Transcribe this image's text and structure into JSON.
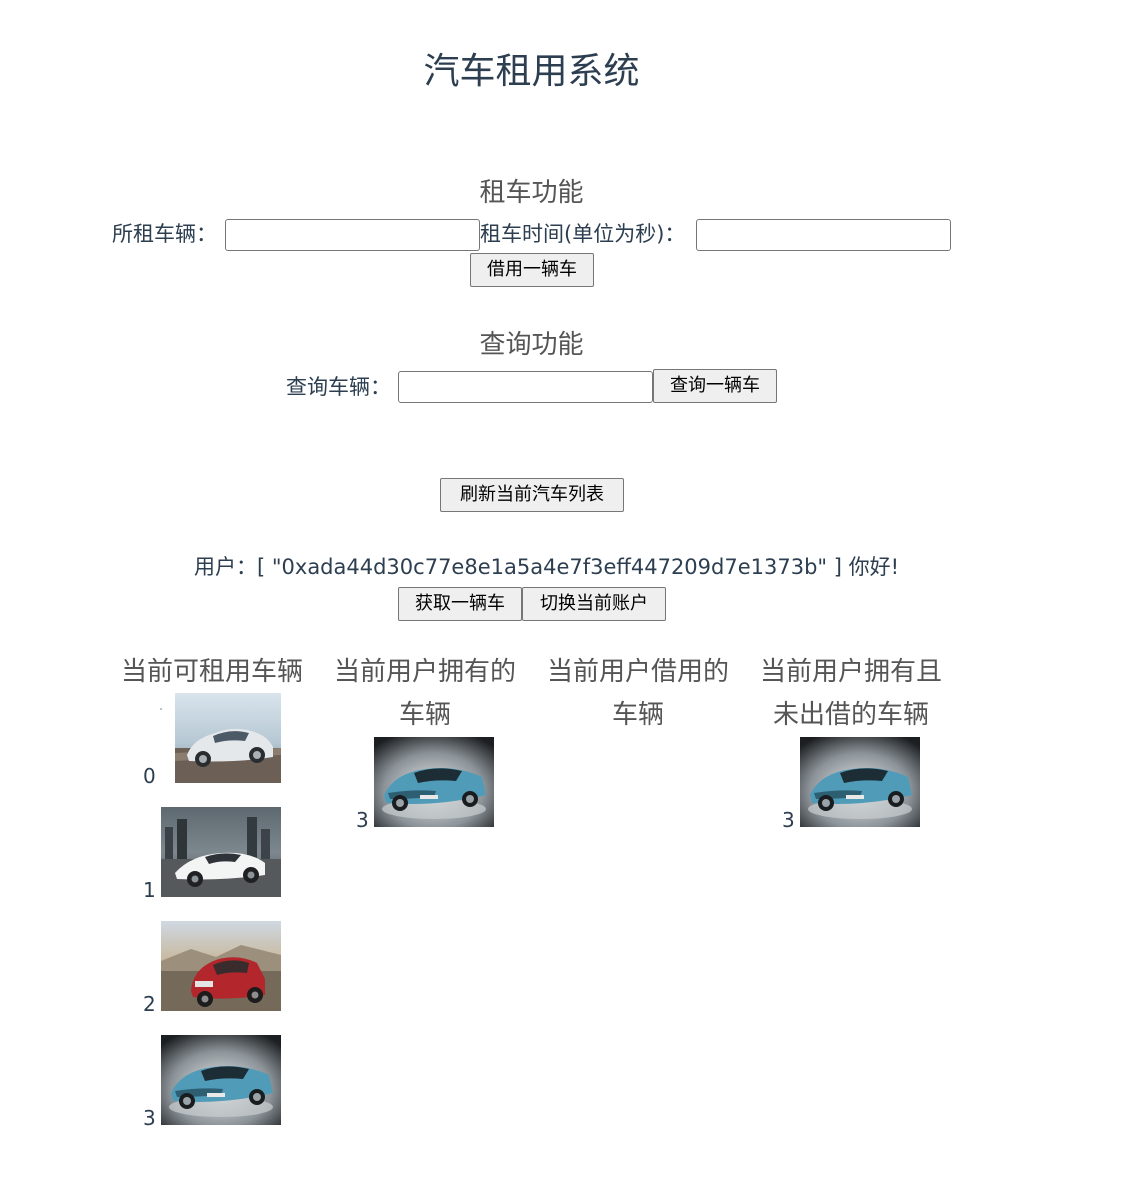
{
  "title": "汽车租用系统",
  "rent": {
    "heading": "租车功能",
    "car_label": "所租车辆：",
    "car_value": "",
    "time_label": "租车时间(单位为秒)：",
    "time_value": "",
    "button": "借用一辆车"
  },
  "query": {
    "heading": "查询功能",
    "car_label": "查询车辆：",
    "car_value": "",
    "button": "查询一辆车"
  },
  "refresh_button": "刷新当前汽车列表",
  "user": {
    "prefix": "用户：",
    "account": "[ \"0xada44d30c77e8e1a5a4e7f3eff447209d7e1373b\" ]",
    "greeting": "你好!",
    "get_car_button": "获取一辆车",
    "switch_button": "切换当前账户"
  },
  "columns": {
    "available": {
      "title_line1": "当前可租用车辆",
      "cars": [
        {
          "id": "0",
          "image": "silver-porsche-sedan"
        },
        {
          "id": "1",
          "image": "white-lamborghini"
        },
        {
          "id": "2",
          "image": "red-bmw-suv"
        },
        {
          "id": "3",
          "image": "blue-concept-sports-car"
        }
      ]
    },
    "owned": {
      "title_line1": "当前用户拥有的",
      "title_line2": "车辆",
      "cars": [
        {
          "id": "3",
          "image": "blue-concept-sports-car"
        }
      ]
    },
    "borrowed": {
      "title_line1": "当前用户借用的",
      "title_line2": "车辆",
      "cars": []
    },
    "owned_not_lent": {
      "title_line1": "当前用户拥有且",
      "title_line2": "未出借的车辆",
      "cars": [
        {
          "id": "3",
          "image": "blue-concept-sports-car"
        }
      ]
    }
  },
  "colors": {
    "text": "#2c3e50",
    "heading": "#555555",
    "button_bg": "#efefef",
    "button_border": "#767676"
  }
}
